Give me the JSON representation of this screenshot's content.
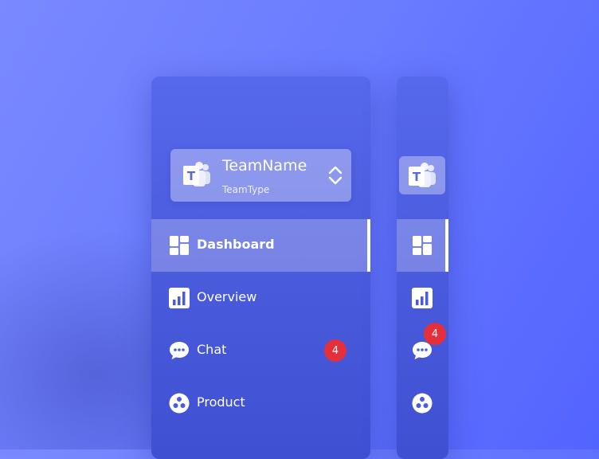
{
  "team": {
    "name": "TeamName",
    "type": "TeamType",
    "logo_letter": "T"
  },
  "nav": [
    {
      "key": "dashboard",
      "label": "Dashboard",
      "icon": "dashboard-grid-icon",
      "active": true
    },
    {
      "key": "overview",
      "label": "Overview",
      "icon": "bar-chart-icon"
    },
    {
      "key": "chat",
      "label": "Chat",
      "icon": "chat-bubble-icon",
      "badge": "4"
    },
    {
      "key": "product",
      "label": "Product",
      "icon": "product-dots-icon"
    }
  ],
  "colors": {
    "badge": "#e5303b",
    "panel": "#4a5bdc",
    "background": "#6a7cff"
  }
}
